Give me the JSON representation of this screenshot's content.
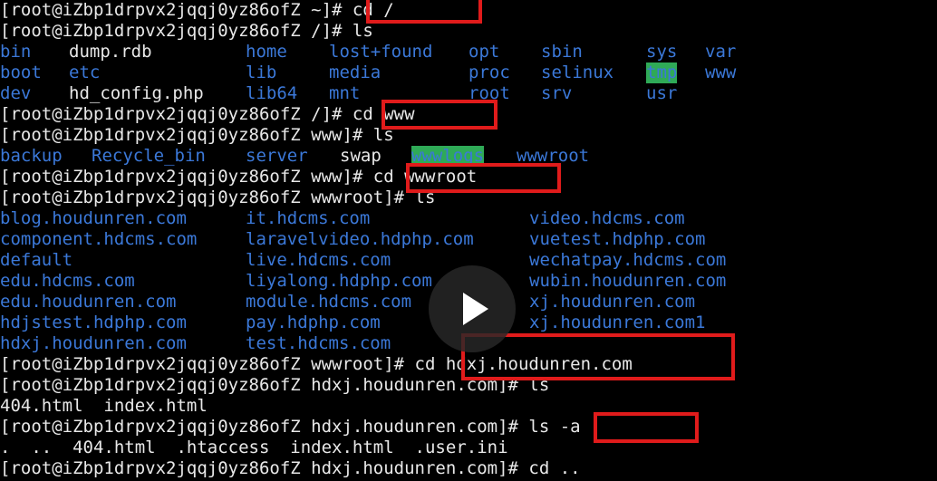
{
  "terminal": {
    "lines": [
      {
        "tokens": [
          {
            "text": "[root@iZbp1drpvx2jqqj0yz86ofZ ~]# cd /",
            "cls": "plain"
          }
        ]
      },
      {
        "tokens": [
          {
            "text": "[root@iZbp1drpvx2jqqj0yz86ofZ /]# ls",
            "cls": "plain"
          }
        ]
      },
      {
        "tokens": [
          {
            "text": "bin",
            "cls": "dir"
          },
          {
            "text": "dump.rdb",
            "cls": "plain"
          },
          {
            "text": "home",
            "cls": "dir"
          },
          {
            "text": "lost+found",
            "cls": "dir"
          },
          {
            "text": "opt",
            "cls": "dir"
          },
          {
            "text": "sbin",
            "cls": "dir"
          },
          {
            "text": "sys",
            "cls": "dir"
          },
          {
            "text": "var",
            "cls": "dir"
          }
        ]
      },
      {
        "tokens": [
          {
            "text": "boot",
            "cls": "dir"
          },
          {
            "text": "etc",
            "cls": "dir"
          },
          {
            "text": "lib",
            "cls": "dir"
          },
          {
            "text": "media",
            "cls": "dir"
          },
          {
            "text": "proc",
            "cls": "dir"
          },
          {
            "text": "selinux",
            "cls": "dir"
          },
          {
            "text": "tmp",
            "cls": "hl"
          },
          {
            "text": "www",
            "cls": "dir"
          }
        ]
      },
      {
        "tokens": [
          {
            "text": "dev",
            "cls": "dir"
          },
          {
            "text": "hd_config.php",
            "cls": "plain"
          },
          {
            "text": "lib64",
            "cls": "dir"
          },
          {
            "text": "mnt",
            "cls": "dir"
          },
          {
            "text": "root",
            "cls": "dir"
          },
          {
            "text": "srv",
            "cls": "dir"
          },
          {
            "text": "usr",
            "cls": "dir"
          }
        ]
      },
      {
        "tokens": [
          {
            "text": "[root@iZbp1drpvx2jqqj0yz86ofZ /]# cd www",
            "cls": "plain"
          }
        ]
      },
      {
        "tokens": [
          {
            "text": "[root@iZbp1drpvx2jqqj0yz86ofZ www]# ls",
            "cls": "plain"
          }
        ]
      },
      {
        "tokens": [
          {
            "text": "backup",
            "cls": "dir"
          },
          {
            "text": "Recycle_bin",
            "cls": "dir"
          },
          {
            "text": "server",
            "cls": "dir"
          },
          {
            "text": "swap",
            "cls": "plain"
          },
          {
            "text": "wwwlogs",
            "cls": "hl"
          },
          {
            "text": "wwwroot",
            "cls": "dir"
          }
        ]
      },
      {
        "tokens": [
          {
            "text": "[root@iZbp1drpvx2jqqj0yz86ofZ www]# cd wwwroot",
            "cls": "plain"
          }
        ]
      },
      {
        "tokens": [
          {
            "text": "[root@iZbp1drpvx2jqqj0yz86ofZ wwwroot]# ls",
            "cls": "plain"
          }
        ]
      },
      {
        "tokens": [
          {
            "text": "blog.houdunren.com",
            "cls": "dir"
          },
          {
            "text": "it.hdcms.com",
            "cls": "dir"
          },
          {
            "text": "video.hdcms.com",
            "cls": "dir"
          }
        ]
      },
      {
        "tokens": [
          {
            "text": "component.hdcms.com",
            "cls": "dir"
          },
          {
            "text": "laravelvideo.hdphp.com",
            "cls": "dir"
          },
          {
            "text": "vuetest.hdphp.com",
            "cls": "dir"
          }
        ]
      },
      {
        "tokens": [
          {
            "text": "default",
            "cls": "dir"
          },
          {
            "text": "live.hdcms.com",
            "cls": "dir"
          },
          {
            "text": "wechatpay.hdcms.com",
            "cls": "dir"
          }
        ]
      },
      {
        "tokens": [
          {
            "text": "edu.hdcms.com",
            "cls": "dir"
          },
          {
            "text": "liyalong.hdphp.com",
            "cls": "dir"
          },
          {
            "text": "wubin.houdunren.com",
            "cls": "dir"
          }
        ]
      },
      {
        "tokens": [
          {
            "text": "edu.houdunren.com",
            "cls": "dir"
          },
          {
            "text": "module.hdcms.com",
            "cls": "dir"
          },
          {
            "text": "xj.houdunren.com",
            "cls": "dir"
          }
        ]
      },
      {
        "tokens": [
          {
            "text": "hdjstest.hdphp.com",
            "cls": "dir"
          },
          {
            "text": "pay.hdphp.com",
            "cls": "dir"
          },
          {
            "text": "xj.houdunren.com1",
            "cls": "dir"
          }
        ]
      },
      {
        "tokens": [
          {
            "text": "hdxj.houdunren.com",
            "cls": "dir"
          },
          {
            "text": "test.hdcms.com",
            "cls": "dir"
          }
        ]
      },
      {
        "tokens": [
          {
            "text": "[root@iZbp1drpvx2jqqj0yz86ofZ wwwroot]# cd hdxj.houdunren.com",
            "cls": "plain"
          }
        ]
      },
      {
        "tokens": [
          {
            "text": "[root@iZbp1drpvx2jqqj0yz86ofZ hdxj.houdunren.com]# ls",
            "cls": "plain"
          }
        ]
      },
      {
        "tokens": [
          {
            "text": "404.html  index.html",
            "cls": "plain"
          }
        ]
      },
      {
        "tokens": [
          {
            "text": "[root@iZbp1drpvx2jqqj0yz86ofZ hdxj.houdunren.com]# ls -a",
            "cls": "plain"
          }
        ]
      },
      {
        "tokens": [
          {
            "text": ".  ..  404.html  .htaccess  index.html  .user.ini",
            "cls": "plain"
          }
        ]
      },
      {
        "tokens": [
          {
            "text": "[root@iZbp1drpvx2jqqj0yz86ofZ hdxj.houdunren.com]# cd ..",
            "cls": "plain"
          }
        ]
      }
    ]
  },
  "colors": {
    "background": "#000000",
    "text": "#e8e8e8",
    "directory": "#3b78d8",
    "highlight_bg": "#2faa57",
    "annotation_box": "#e01b1b"
  },
  "overlay": {
    "play_button_icon": "play-icon"
  }
}
